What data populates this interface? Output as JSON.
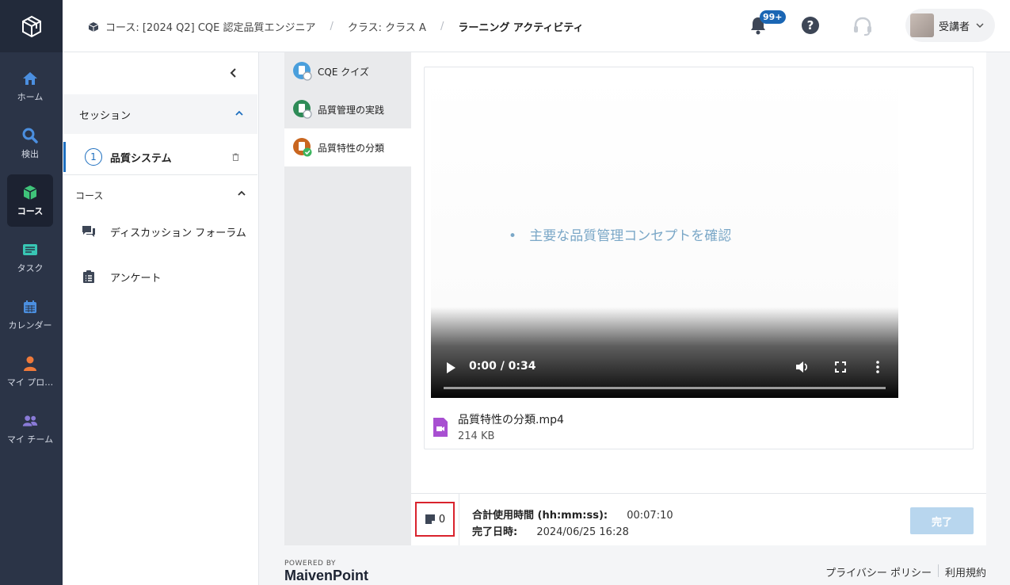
{
  "nav": {
    "items": [
      {
        "label": "ホーム",
        "icon": "home-icon"
      },
      {
        "label": "検出",
        "icon": "search-icon"
      },
      {
        "label": "コース",
        "icon": "course-cube-icon"
      },
      {
        "label": "タスク",
        "icon": "task-icon"
      },
      {
        "label": "カレンダー",
        "icon": "calendar-icon"
      },
      {
        "label": "マイ プロ…",
        "icon": "person-icon"
      },
      {
        "label": "マイ チーム",
        "icon": "team-icon"
      }
    ],
    "active_index": 2
  },
  "breadcrumb": {
    "course": "コース: [2024 Q2] CQE 認定品質エンジニア",
    "class": "クラス: クラス A",
    "current": "ラーニング アクティビティ"
  },
  "header": {
    "notification_badge": "99+",
    "user_name": "受講者"
  },
  "session_panel": {
    "section_title": "セッション",
    "sessions": [
      {
        "number": "1",
        "label": "品質システム"
      }
    ],
    "course_section_title": "コース",
    "links": [
      {
        "label": "ディスカッション フォーラム",
        "icon": "discussion-icon"
      },
      {
        "label": "アンケート",
        "icon": "survey-clipboard-icon"
      }
    ]
  },
  "activities": [
    {
      "label": "CQE クイズ",
      "icon": "quiz-doc-icon",
      "color": "#4a9fdc"
    },
    {
      "label": "品質管理の実践",
      "icon": "doc-icon",
      "color": "#2e8b57"
    },
    {
      "label": "品質特性の分類",
      "icon": "video-doc-icon",
      "color": "#c9661f"
    }
  ],
  "video": {
    "slide_text": "主要な品質管理コンセプトを確認",
    "time": "0:00 / 0:34",
    "progress": 0,
    "file_name": "品質特性の分類.mp4",
    "file_size": "214 KB"
  },
  "status": {
    "note_count": "0",
    "total_time_label": "合計使用時間 (hh:mm:ss):",
    "total_time_value": "00:07:10",
    "completed_label": "完了日時:",
    "completed_value": "2024/06/25 16:28",
    "done_button": "完了"
  },
  "footer": {
    "powered_by": "POWERED BY",
    "brand": "MaivenPoint",
    "privacy": "プライバシー ポリシー",
    "terms": "利用規約"
  },
  "colors": {
    "nav_bg": "#2b3447",
    "accent": "#1e6fbf",
    "done_button": "#b8d6ee",
    "highlight_border": "#d9232d"
  }
}
